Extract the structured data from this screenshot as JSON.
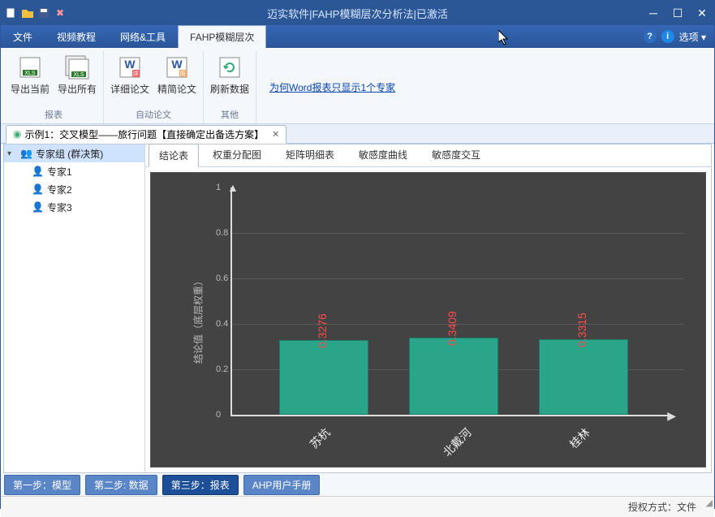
{
  "window": {
    "title": "迈实软件|FAHP模糊层次分析法|已激活"
  },
  "menubar": {
    "items": [
      "文件",
      "视频教程",
      "网络&工具",
      "FAHP模糊层次"
    ],
    "active_index": 3,
    "options_label": "选项"
  },
  "ribbon": {
    "groups": [
      {
        "title": "报表",
        "items": [
          {
            "label": "导出当前"
          },
          {
            "label": "导出所有"
          }
        ]
      },
      {
        "title": "自动论文",
        "items": [
          {
            "label": "详细论文"
          },
          {
            "label": "精简论文"
          }
        ]
      },
      {
        "title": "其他",
        "items": [
          {
            "label": "刷新数据"
          }
        ]
      }
    ],
    "link": "为何Word报表只显示1个专家"
  },
  "document_tab": {
    "title": "示例1：交叉模型——旅行问题【直接确定出备选方案】"
  },
  "tree": {
    "root": "专家组 (群决策)",
    "children": [
      "专家1",
      "专家2",
      "专家3"
    ]
  },
  "chart_tabs": {
    "items": [
      "结论表",
      "权重分配图",
      "矩阵明细表",
      "敏感度曲线",
      "敏感度交互"
    ],
    "active_index": 0
  },
  "chart_data": {
    "type": "bar",
    "ylabel": "结论值（底层权重）",
    "categories": [
      "苏杭",
      "北戴河",
      "桂林"
    ],
    "values": [
      0.3276,
      0.3409,
      0.3315
    ],
    "ylim": [
      0,
      1
    ],
    "yticks": [
      0,
      0.2,
      0.4,
      0.6,
      0.8,
      1
    ]
  },
  "steps": {
    "items": [
      "第一步：模型",
      "第二步: 数据",
      "第三步：报表",
      "AHP用户手册"
    ],
    "active_index": 2
  },
  "status": {
    "text": "授权方式：文件"
  }
}
